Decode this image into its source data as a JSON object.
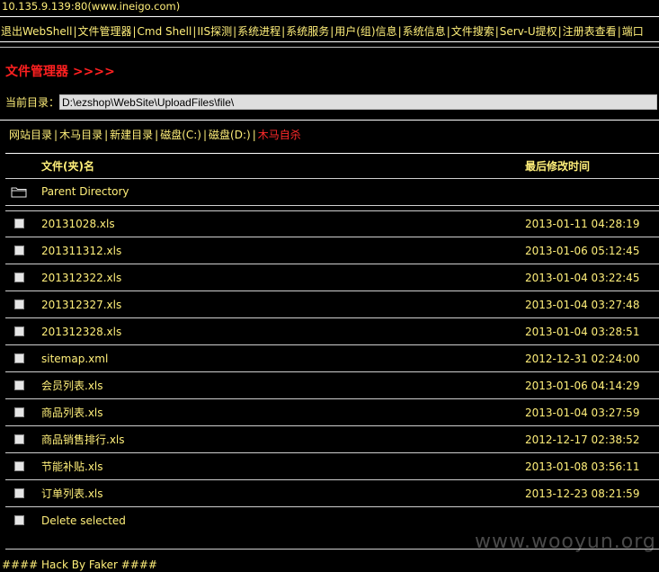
{
  "header": {
    "host": "10.135.9.139:80(www.ineigo.com)"
  },
  "menu": {
    "items": [
      "退出WebShell",
      "文件管理器",
      "Cmd Shell",
      "IIS探测",
      "系统进程",
      "系统服务",
      "用户(组)信息",
      "系统信息",
      "文件搜索",
      "Serv-U提权",
      "注册表查看",
      "端口"
    ],
    "separator": "|"
  },
  "page_title": "文件管理器 >>>>",
  "current_dir": {
    "label": "当前目录：",
    "value": "D:\\ezshop\\WebSite\\UploadFiles\\file\\"
  },
  "subnav": {
    "items": [
      "网站目录",
      "木马目录",
      "新建目录",
      "磁盘(C:)",
      "磁盘(D:)"
    ],
    "kill": "木马自杀",
    "separator": "|"
  },
  "table": {
    "col_name": "文件(夹)名",
    "col_time": "最后修改时间",
    "parent": "Parent Directory",
    "files": [
      {
        "name": "20131028.xls",
        "time": "2013-01-11 04:28:19"
      },
      {
        "name": "201311312.xls",
        "time": "2013-01-06 05:12:45"
      },
      {
        "name": "201312322.xls",
        "time": "2013-01-04 03:22:45"
      },
      {
        "name": "201312327.xls",
        "time": "2013-01-04 03:27:48"
      },
      {
        "name": "201312328.xls",
        "time": "2013-01-04 03:28:51"
      },
      {
        "name": "sitemap.xml",
        "time": "2012-12-31 02:24:00"
      },
      {
        "name": "会员列表.xls",
        "time": "2013-01-06 04:14:29"
      },
      {
        "name": "商品列表.xls",
        "time": "2013-01-04 03:27:59"
      },
      {
        "name": "商品销售排行.xls",
        "time": "2012-12-17 02:38:52"
      },
      {
        "name": "节能补贴.xls",
        "time": "2013-01-08 03:56:11"
      },
      {
        "name": "订单列表.xls",
        "time": "2013-12-23 08:21:59"
      }
    ],
    "delete_label": "Delete selected"
  },
  "watermark": "www.wooyun.org",
  "footer": "#### Hack By Faker ####"
}
